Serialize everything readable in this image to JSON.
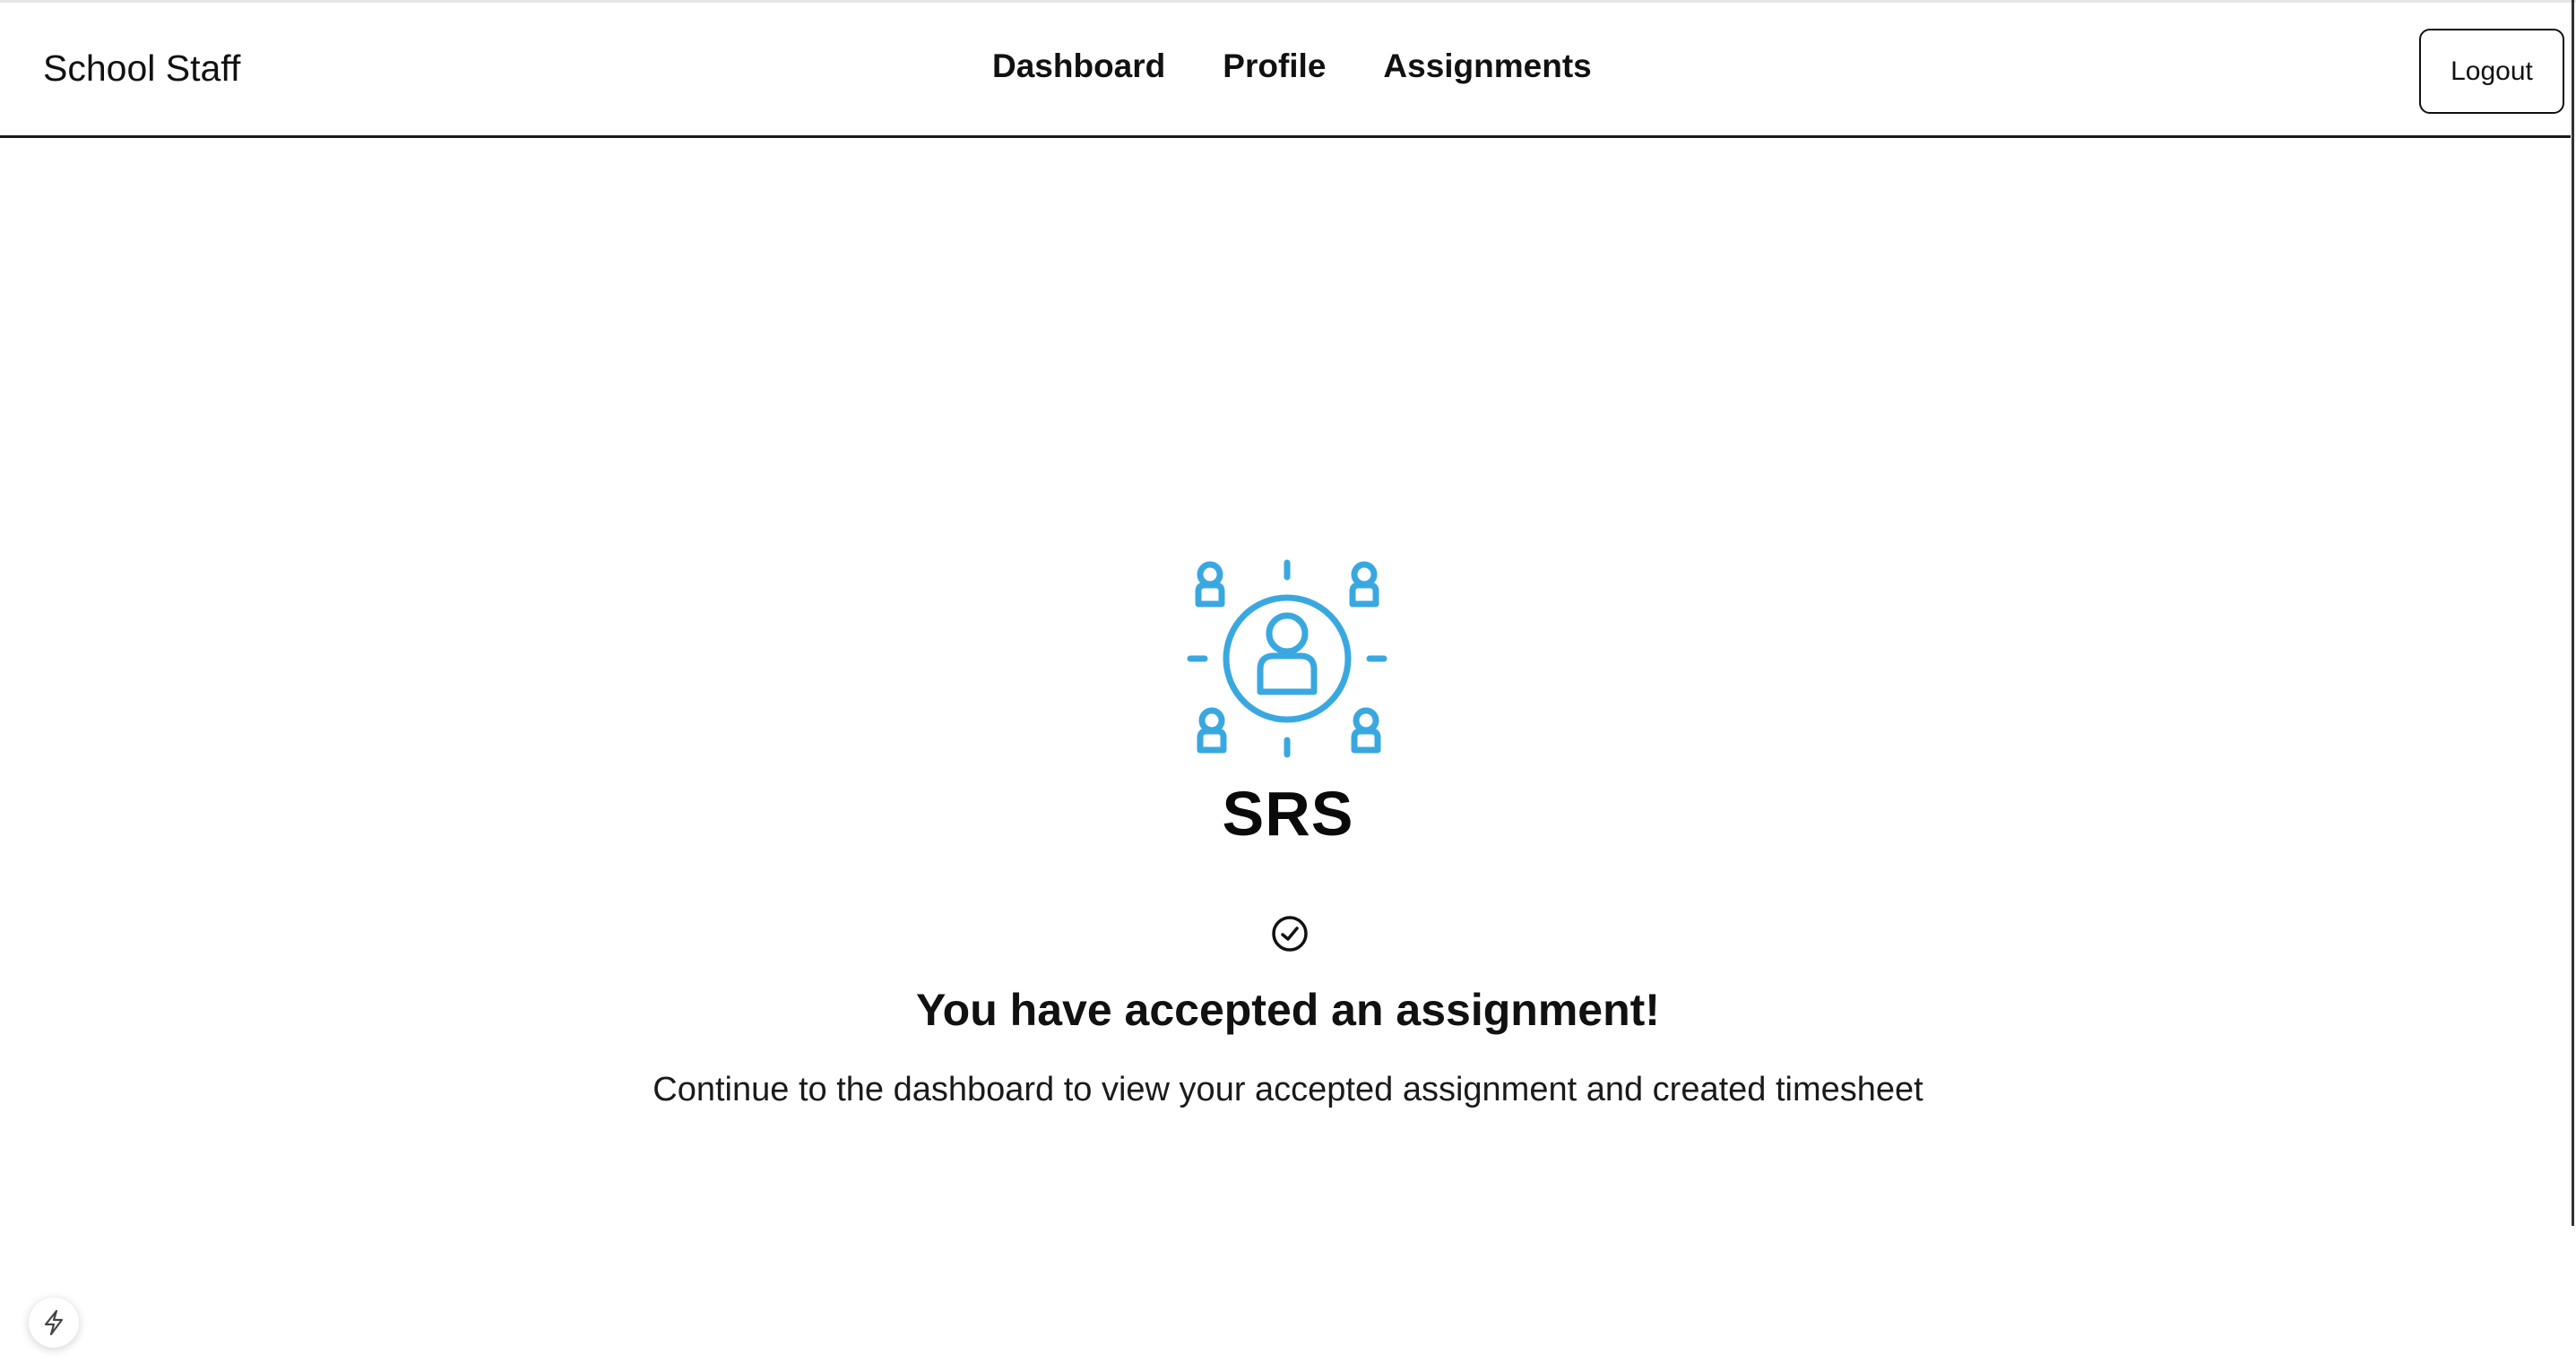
{
  "header": {
    "brand": "School Staff",
    "nav": [
      {
        "label": "Dashboard"
      },
      {
        "label": "Profile"
      },
      {
        "label": "Assignments"
      }
    ],
    "logout_label": "Logout"
  },
  "main": {
    "logo_icon": "people-network-icon",
    "brand_title": "SRS",
    "status_icon": "check-circle-icon",
    "heading": "You have accepted an assignment!",
    "message": "Continue to the dashboard to view your accepted assignment and created timesheet"
  },
  "floating": {
    "icon": "lightning-icon"
  },
  "colors": {
    "accent": "#3aa8e0",
    "text": "#0a0a0a",
    "border": "#1a1a1a"
  }
}
